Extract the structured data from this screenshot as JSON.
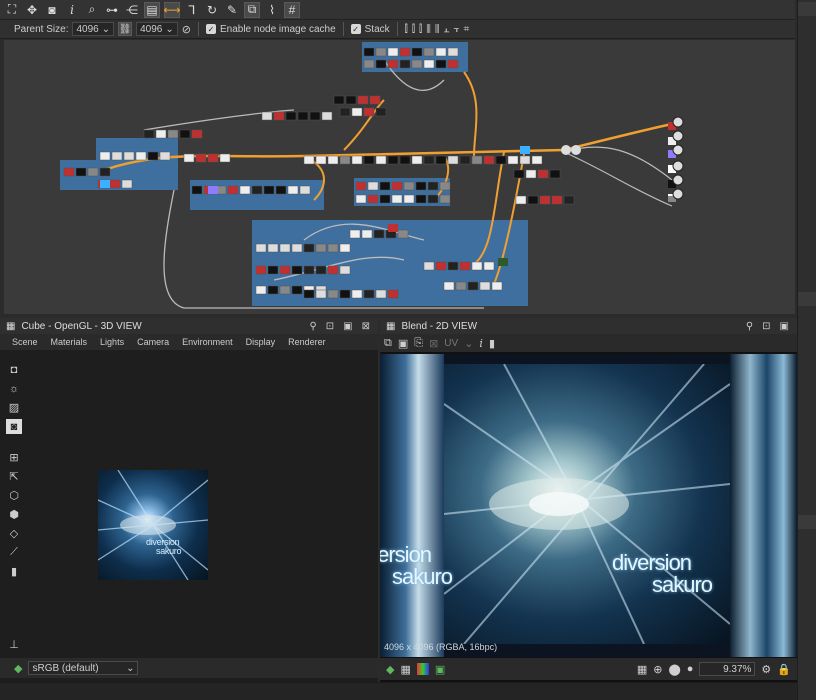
{
  "toolbar": {
    "icons": [
      "frame-icon",
      "move-icon",
      "camera-icon",
      "info-icon",
      "search-icon",
      "link-icon",
      "graph-icon",
      "layout-icon",
      "connect-icon",
      "align-icon",
      "rotate-icon",
      "tools-icon",
      "export-icon",
      "brush-icon",
      "grid-icon"
    ]
  },
  "options": {
    "parent_size_label": "Parent Size:",
    "parent_size_value": "4096",
    "size_value": "4096",
    "cache_label": "Enable node image cache",
    "stack_label": "Stack"
  },
  "panel3d": {
    "title": "Cube - OpenGL - 3D VIEW",
    "menu": [
      "Scene",
      "Materials",
      "Lights",
      "Camera",
      "Environment",
      "Display",
      "Renderer"
    ],
    "colorspace": "sRGB (default)"
  },
  "panel2d": {
    "title": "Blend - 2D VIEW",
    "uv_label": "UV",
    "status": "4096 x 4096 (RGBA, 16bpc)",
    "zoom": "9.37%"
  },
  "texture": {
    "line1": "diversion",
    "line2": "sakuro"
  },
  "colors": {
    "accent": "#f0a030",
    "frame": "#3f6f9e",
    "bg": "#1e1e1e"
  }
}
